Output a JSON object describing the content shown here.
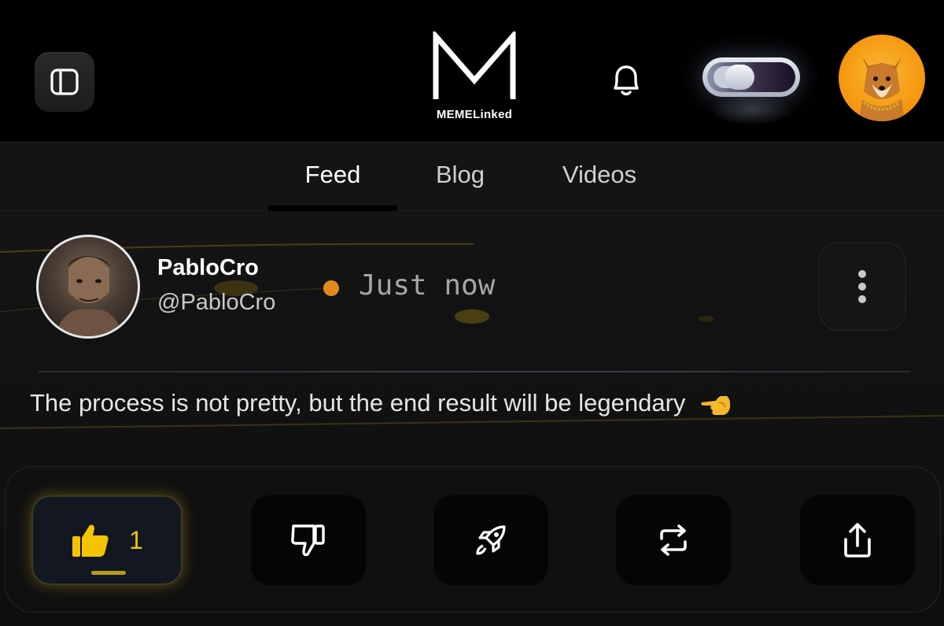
{
  "header": {
    "logo_letter": "M",
    "logo_text": "MEMELinked",
    "icons": [
      "sidebar-toggle-icon",
      "bell-icon",
      "theme-toggle-switch",
      "user-avatar"
    ]
  },
  "tabs": [
    {
      "label": "Feed",
      "active": true
    },
    {
      "label": "Blog",
      "active": false
    },
    {
      "label": "Videos",
      "active": false
    }
  ],
  "post": {
    "author_name": "PabloCro",
    "author_handle": "@PabloCro",
    "time": "Just now",
    "text": "The process is not pretty, but the end result will be legendary",
    "emoji": "pointing-hand-icon",
    "actions": {
      "like_count": "1",
      "like_active": true,
      "icons": [
        "thumbs-up-icon",
        "thumbs-down-icon",
        "rocket-icon",
        "repost-icon",
        "share-icon"
      ]
    }
  },
  "colors": {
    "background": "#000000",
    "accent_yellow": "#f5c400",
    "time_dot": "#e08a1e"
  }
}
